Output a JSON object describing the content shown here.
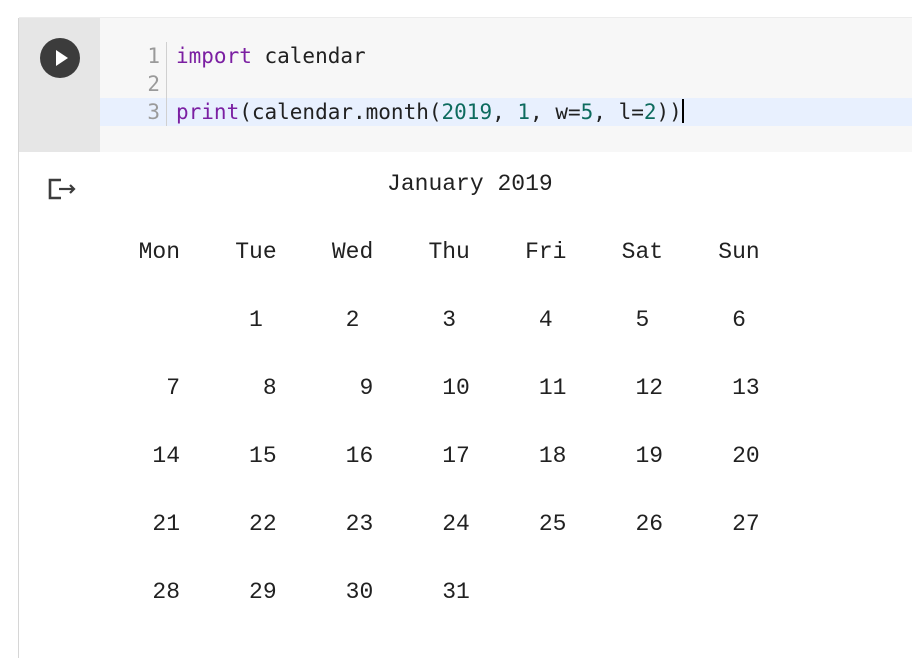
{
  "notebook": {
    "cell": {
      "run_button_icon": "play-icon",
      "lines": [
        {
          "num": "1",
          "tokens": [
            {
              "t": "import",
              "c": "kw"
            },
            {
              "t": " calendar",
              "c": ""
            }
          ]
        },
        {
          "num": "2",
          "tokens": []
        },
        {
          "num": "3",
          "tokens": [
            {
              "t": "print",
              "c": "bi"
            },
            {
              "t": "(calendar.month(",
              "c": ""
            },
            {
              "t": "2019",
              "c": "num"
            },
            {
              "t": ", ",
              "c": ""
            },
            {
              "t": "1",
              "c": "num"
            },
            {
              "t": ", w=",
              "c": ""
            },
            {
              "t": "5",
              "c": "num"
            },
            {
              "t": ", l=",
              "c": ""
            },
            {
              "t": "2",
              "c": "num"
            },
            {
              "t": "))",
              "c": ""
            }
          ]
        }
      ]
    },
    "output": {
      "icon": "output-clear-icon",
      "lines": [
        "                    January 2019",
        "",
        "  Mon    Tue    Wed    Thu    Fri    Sat    Sun",
        "",
        "          1      2      3      4      5      6",
        "",
        "    7      8      9     10     11     12     13",
        "",
        "   14     15     16     17     18     19     20",
        "",
        "   21     22     23     24     25     26     27",
        "",
        "   28     29     30     31"
      ]
    }
  },
  "colors": {
    "keyword": "#7b1fa2",
    "number": "#0d6b5e",
    "gutter": "#e6e6e6",
    "editor_bg": "#f7f7f7",
    "active_line": "#e8f0fe"
  }
}
